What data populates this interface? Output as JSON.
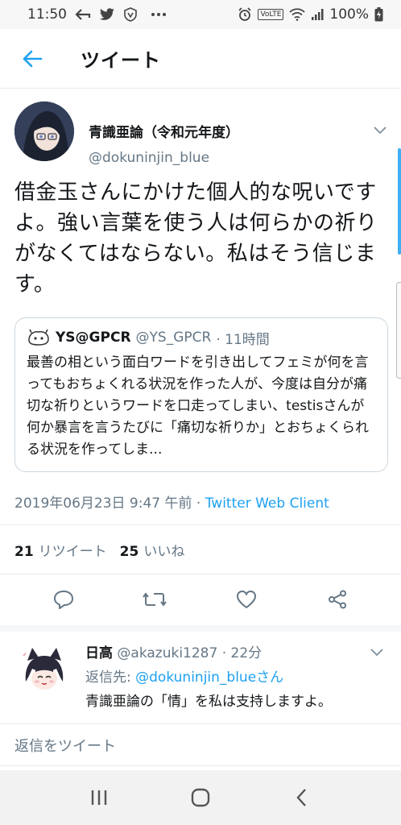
{
  "status_bar": {
    "time": "11:50",
    "battery": "100%",
    "left_icons": [
      "back-arrow-icon",
      "twitter-bird-icon",
      "shield-icon",
      "more-dots-icon"
    ],
    "right_icons": [
      "alarm-icon",
      "volte-icon",
      "wifi-icon",
      "signal-icon",
      "battery-icon"
    ],
    "volte_label": "VoLTE"
  },
  "app_bar": {
    "title": "ツイート"
  },
  "tweet": {
    "author_name": "青識亜論（令和元年度）",
    "author_handle": "@dokuninjin_blue",
    "text": "借金玉さんにかけた個人的な呪いですよ。強い言葉を使う人は何らかの祈りがなくてはならない。私はそう信じます。",
    "quote": {
      "name": "YS@GPCR",
      "handle": "@YS_GPCR",
      "time": "· 11時間",
      "text": "最善の相という面白ワードを引き出してフェミが何を言ってもおちょくれる状況を作った人が、今度は自分が痛切な祈りというワードを口走ってしまい、testisさんが何か暴言を言うたびに「痛切な祈りか」とおちょくられる状況を作ってしま..."
    },
    "date": "2019年06月23日 9:47 午前",
    "separator": " · ",
    "client": "Twitter Web Client",
    "retweets_count": "21",
    "retweets_label": "リツイート",
    "likes_count": "25",
    "likes_label": "いいね"
  },
  "reply": {
    "name": "日高",
    "handle": "@akazuki1287",
    "time": "· 22分",
    "reply_to_prefix": "返信先: ",
    "reply_to_mention": "@dokuninjin_blue",
    "reply_to_suffix": "さん",
    "text": "青識亜論の「情」を私は支持しますよ。"
  },
  "compose": {
    "placeholder": "返信をツイート"
  },
  "colors": {
    "accent": "#1da1f2",
    "secondary_text": "#657786",
    "border": "#e6ecf0"
  }
}
